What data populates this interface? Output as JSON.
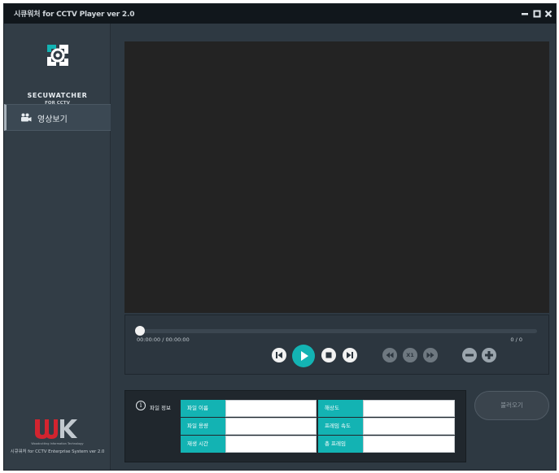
{
  "window": {
    "title": "시큐워처 for CCTV Player ver 2.0",
    "controls": [
      "minimize",
      "maximize",
      "close"
    ]
  },
  "sidebar": {
    "logo_text": "SECUWATCHER",
    "logo_subtext": "FOR CCTV",
    "menu": [
      {
        "label": "영상보기",
        "icon": "video-camera-icon",
        "active": true
      }
    ],
    "company_tagline": "Woodcutting Information Technology",
    "footer": "시큐워처 for CCTV Enterprise System ver 2.0"
  },
  "player": {
    "progress": 0,
    "time": "00:00:00 / 00:00:00",
    "frames": "0 / 0",
    "speed_label": "X1",
    "buttons": [
      "previous",
      "play",
      "stop",
      "next",
      "rewind",
      "speed",
      "fast-forward",
      "zoom-out",
      "zoom-in"
    ]
  },
  "file_info": {
    "title": "파일 정보",
    "left": [
      {
        "label": "파일 이름",
        "value": ""
      },
      {
        "label": "파일 용량",
        "value": ""
      },
      {
        "label": "재생 시간",
        "value": ""
      }
    ],
    "right": [
      {
        "label": "해상도",
        "value": ""
      },
      {
        "label": "프레임 속도",
        "value": ""
      },
      {
        "label": "총 프레임",
        "value": ""
      }
    ]
  },
  "load_button": "불러오기",
  "colors": {
    "accent": "#13b3b3",
    "window_bg": "#2e3942",
    "video_bg": "#232323"
  }
}
